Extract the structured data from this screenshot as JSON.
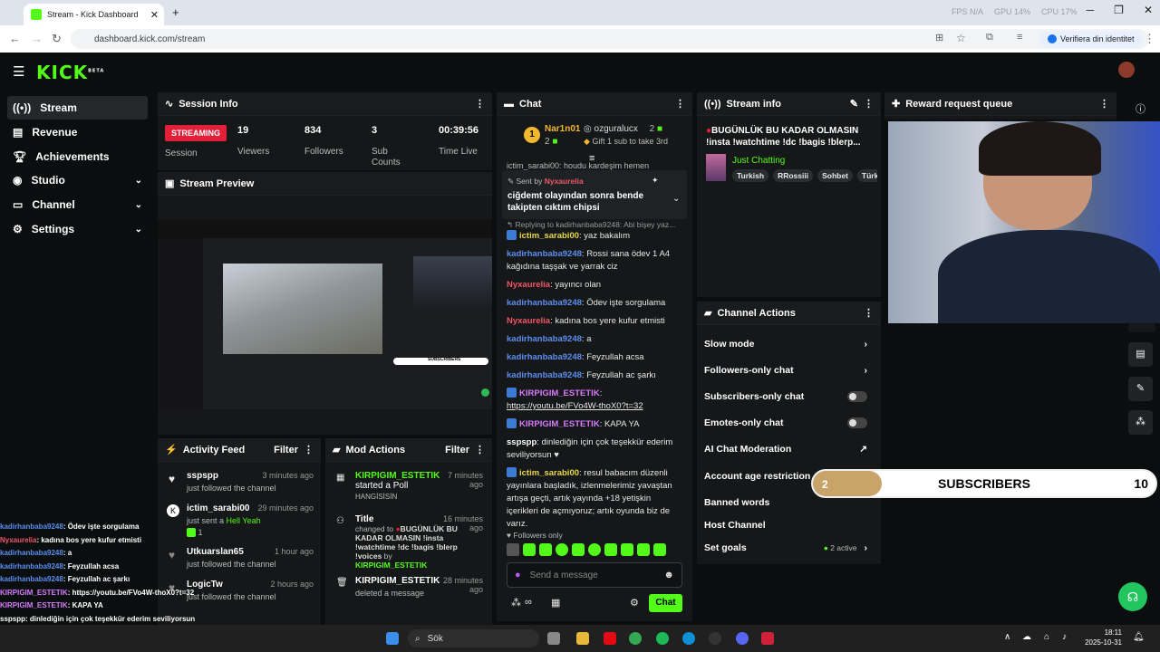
{
  "browser": {
    "tab_title": "Stream - Kick Dashboard",
    "url": "dashboard.kick.com/stream",
    "verify_label": "Verifiera din identitet",
    "stats": [
      "FPS N/A",
      "GPU 14%",
      "CPU 17%"
    ]
  },
  "header": {
    "logo": "KICK",
    "beta": "BETA"
  },
  "sidebar": {
    "items": [
      {
        "label": "Stream",
        "icon": "broadcast-icon",
        "active": true
      },
      {
        "label": "Revenue",
        "icon": "revenue-icon"
      },
      {
        "label": "Achievements",
        "icon": "trophy-icon"
      },
      {
        "label": "Studio",
        "icon": "studio-icon",
        "expandable": true
      },
      {
        "label": "Channel",
        "icon": "channel-icon",
        "expandable": true
      },
      {
        "label": "Settings",
        "icon": "gear-icon",
        "expandable": true
      }
    ]
  },
  "session": {
    "title": "Session Info",
    "status": "STREAMING",
    "status_label": "Session",
    "viewers": "19",
    "viewers_label": "Viewers",
    "followers": "834",
    "followers_label": "Followers",
    "subs": "3",
    "subs_label": "Sub Counts",
    "time": "00:39:56",
    "time_label": "Time Live"
  },
  "preview": {
    "title": "Stream Preview",
    "subscribers_label": "SUBSCRIBERS"
  },
  "chat": {
    "title": "Chat",
    "gifter1_name": "Nar1n01",
    "gifter1_count": "2",
    "gifter2_name": "ozguralucx",
    "gifter2_count": "2",
    "gift_note": "Gift 1 sub to take 3rd",
    "pinned_sender_prefix": "Sent by",
    "pinned_sender": "Nyxaurelia",
    "pinned_text": "ciğdemt olayından sonra bende takipten cıktım chipsi",
    "cut_line": "ictim_sarabi00: houdu kardeşim hemen",
    "reply_note": "Replying to kadirhanbaba9248: Abi bişey yaz...",
    "messages": [
      {
        "user": "ictim_sarabi00",
        "text": "yaz bakalım",
        "color": "u-yellow",
        "badge": true
      },
      {
        "user": "kadirhanbaba9248",
        "text": "Rossi sana ödev 1 A4 kağıdına taşşak ve yarrak ciz",
        "color": "u-blue"
      },
      {
        "user": "Nyxaurelia",
        "text": "yayıncı olan",
        "color": "u-red"
      },
      {
        "user": "kadirhanbaba9248",
        "text": "Ödev işte sorgulama",
        "color": "u-blue"
      },
      {
        "user": "Nyxaurelia",
        "text": "kadına bos yere kufur etmisti",
        "color": "u-red"
      },
      {
        "user": "kadirhanbaba9248",
        "text": "a",
        "color": "u-blue"
      },
      {
        "user": "kadirhanbaba9248",
        "text": "Feyzullah acsa",
        "color": "u-blue"
      },
      {
        "user": "kadirhanbaba9248",
        "text": "Feyzullah ac şarkı",
        "color": "u-blue"
      },
      {
        "user": "KIRPIGIM_ESTETIK",
        "text": "https://youtu.be/FVo4W-thoX0?t=32",
        "color": "u-purple",
        "badge": true
      },
      {
        "user": "KIRPIGIM_ESTETIK",
        "text": "KAPA YA",
        "color": "u-purple",
        "badge": true
      },
      {
        "user": "sspspp",
        "text": "dinlediğin için çok teşekkür ederim seviliyorsun ♥",
        "color": "u-white"
      },
      {
        "user": "ictim_sarabi00",
        "text": "resul babacım düzenli yayınlara başladık, izlenmelerimiz yavaştan artışa geçti, artık yayında +18 yetişkin içerikleri de açmıyoruz; artık oyunda biz de varız.",
        "color": "u-yellow",
        "badge": true
      }
    ],
    "followers_only": "Followers only",
    "input_placeholder": "Send a message",
    "send_label": "Chat"
  },
  "activity": {
    "title": "Activity Feed",
    "filter": "Filter",
    "items": [
      {
        "name": "sspspp",
        "desc": "just followed the channel",
        "time": "3 minutes ago"
      },
      {
        "name": "ictim_sarabi00",
        "desc": "just sent a",
        "extra": "Hell Yeah",
        "time": "29 minutes ago",
        "count": "1"
      },
      {
        "name": "Utkuarslan65",
        "desc": "just followed the channel",
        "time": "1 hour ago"
      },
      {
        "name": "LogicTw",
        "desc": "just followed the channel",
        "time": "2 hours ago"
      }
    ]
  },
  "mod": {
    "title": "Mod Actions",
    "filter": "Filter",
    "items": [
      {
        "user": "KIRPIGIM_ESTETIK",
        "action": "started a Poll",
        "detail": "HANGİSİSİN",
        "time": "7 minutes ago"
      },
      {
        "user": "Title",
        "action": "changed to",
        "detail": "BUGÜNLÜK BU KADAR OLMASIN !insta !watchtime !dc !bagis !blerp !voices",
        "by": "by",
        "byuser": "KIRPIGIM_ESTETIK",
        "time": "16 minutes ago"
      },
      {
        "user": "KIRPIGIM_ESTETIK",
        "action": "deleted a message",
        "time": "28 minutes ago"
      }
    ]
  },
  "stream_info": {
    "title": "Stream info",
    "stream_title": "BUGÜNLÜK BU KADAR OLMASIN !insta !watchtime !dc !bagis !blerp...",
    "category": "Just Chatting",
    "tags": [
      "Turkish",
      "RRossiii",
      "Sohbet",
      "Türk"
    ]
  },
  "reward_queue": {
    "title": "Reward request queue"
  },
  "channel_actions": {
    "title": "Channel Actions",
    "rows": [
      {
        "label": "Slow mode",
        "control": "chevron"
      },
      {
        "label": "Followers-only chat",
        "control": "chevron"
      },
      {
        "label": "Subscribers-only chat",
        "control": "toggle"
      },
      {
        "label": "Emotes-only chat",
        "control": "toggle"
      },
      {
        "label": "AI Chat Moderation",
        "control": "external"
      },
      {
        "label": "Account age restriction",
        "control": "chevron"
      },
      {
        "label": "Banned words",
        "control": "chevron"
      },
      {
        "label": "Host Channel",
        "control": "none"
      },
      {
        "label": "Set goals",
        "control": "chevron",
        "badge": "2 active"
      }
    ]
  },
  "sub_goal": {
    "current": "2",
    "label": "SUBSCRIBERS",
    "target": "10",
    "progress": 0.2
  },
  "overlay_chat": [
    {
      "user": "kadirhanbaba9248",
      "text": ": Ödev işte sorgulama",
      "color": "#5b8ef0"
    },
    {
      "user": "Nyxaurelia",
      "text": ": kadına bos yere kufur etmisti",
      "color": "#f0566a"
    },
    {
      "user": "kadirhanbaba9248",
      "text": ": a",
      "color": "#5b8ef0"
    },
    {
      "user": "kadirhanbaba9248",
      "text": ": Feyzullah acsa",
      "color": "#5b8ef0"
    },
    {
      "user": "kadirhanbaba9248",
      "text": ": Feyzullah ac şarkı",
      "color": "#5b8ef0"
    },
    {
      "user": "KIRPIGIM_ESTETIK",
      "text": ": https://youtu.be/FVo4W-thoX0?t=32",
      "color": "#d77bff"
    },
    {
      "user": "KIRPIGIM_ESTETIK",
      "text": ": KAPA YA",
      "color": "#d77bff"
    },
    {
      "user": "sspspp",
      "text": ": dinlediğin için çok teşekkür ederim seviliyorsun",
      "color": "#ffffff"
    },
    {
      "user": "ictim_sarabi00",
      "text": ": resul babacım düzenli yayınlara başladık, izlenmelerimiz yavaştan artışa geçti, artık",
      "color": "#e8d84a"
    },
    {
      "user": "",
      "text": "yayında +18 yetişkin içerikleri de açmıyoruz; artık oyunda biz de varız.",
      "color": "#ffffff"
    }
  ],
  "taskbar": {
    "search": "Sök",
    "time": "18:11",
    "date": "2025-10-31"
  },
  "colors": {
    "kick_green": "#53fc18",
    "streaming_red": "#e2203a",
    "panel_bg": "#151718"
  }
}
